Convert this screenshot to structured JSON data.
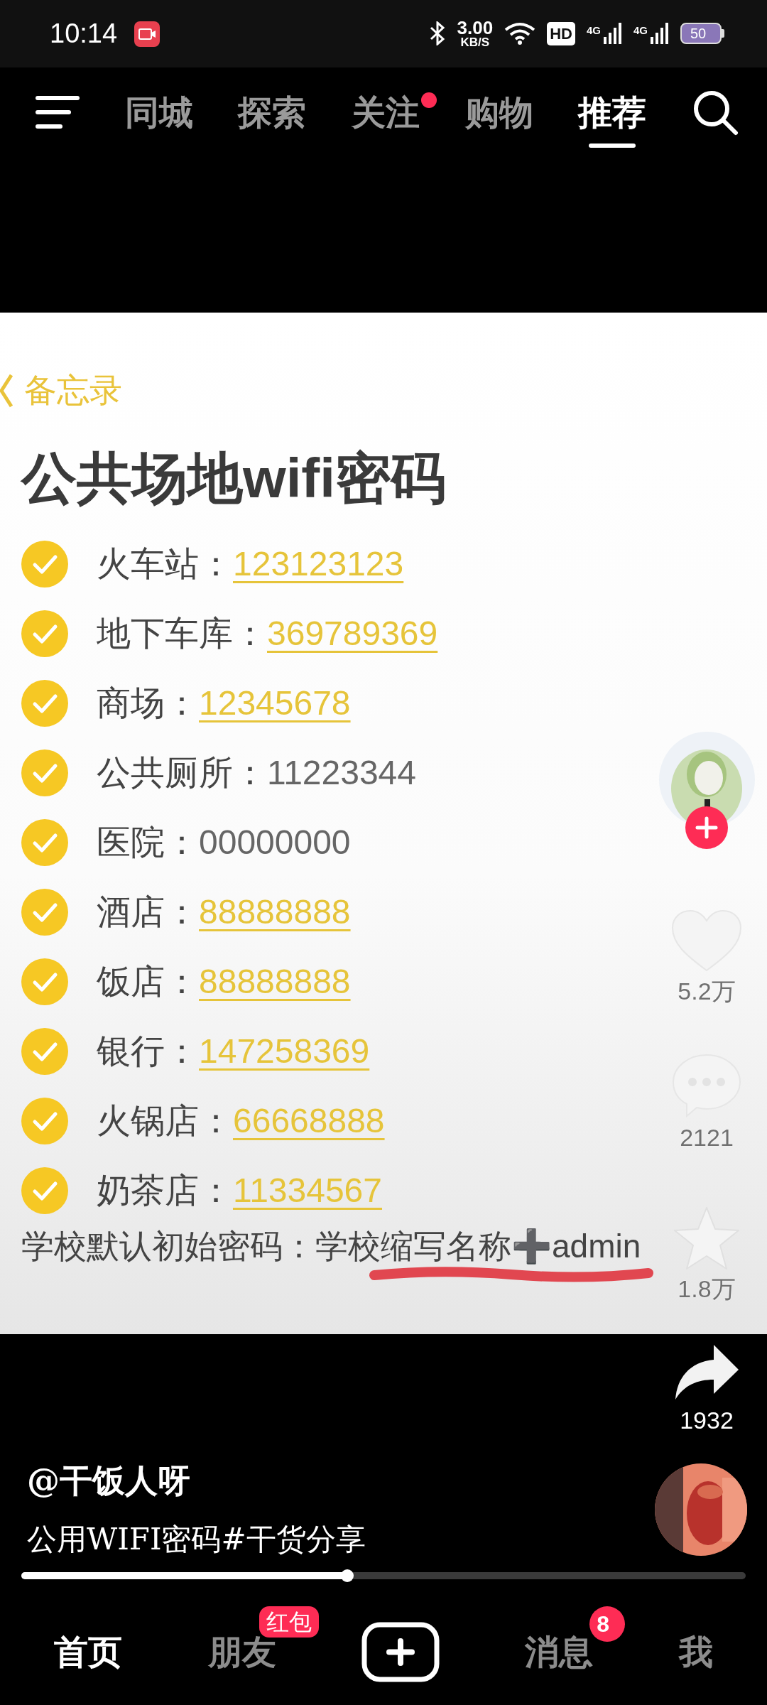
{
  "status_bar": {
    "time": "10:14",
    "speed": "3.00",
    "speed_unit": "KB/S",
    "hd": "HD",
    "networks": [
      "4G",
      "4G"
    ],
    "battery": "50"
  },
  "top_tabs": [
    {
      "label": "同城",
      "selected": false,
      "dot": false
    },
    {
      "label": "探索",
      "selected": false,
      "dot": false
    },
    {
      "label": "关注",
      "selected": false,
      "dot": true
    },
    {
      "label": "购物",
      "selected": false,
      "dot": false
    },
    {
      "label": "推荐",
      "selected": true,
      "dot": false
    }
  ],
  "memo": {
    "back_label": "备忘录",
    "title": "公共场地wifi密码",
    "items": [
      {
        "label": "火车站：",
        "value": "123123123",
        "linked": true
      },
      {
        "label": "地下车库：",
        "value": "369789369",
        "linked": true
      },
      {
        "label": "商场：",
        "value": "12345678",
        "linked": true
      },
      {
        "label": "公共厕所：",
        "value": "11223344",
        "linked": false
      },
      {
        "label": "医院：",
        "value": "00000000",
        "linked": false
      },
      {
        "label": "酒店：",
        "value": "88888888",
        "linked": true
      },
      {
        "label": "饭店：",
        "value": "88888888",
        "linked": true
      },
      {
        "label": "银行：",
        "value": "147258369",
        "linked": true
      },
      {
        "label": "火锅店：",
        "value": "66668888",
        "linked": true
      },
      {
        "label": "奶茶店：",
        "value": "11334567",
        "linked": true
      }
    ],
    "footer": "学校默认初始密码：学校缩写名称➕admin"
  },
  "actions": [
    {
      "kind": "like",
      "count": "5.2万"
    },
    {
      "kind": "comment",
      "count": "2121"
    },
    {
      "kind": "favorite",
      "count": "1.8万"
    },
    {
      "kind": "share",
      "count": "1932"
    }
  ],
  "author": "@干饭人呀",
  "caption": "公用WIFI密码#干货分享",
  "progress": {
    "level": 0.45
  },
  "bottom_nav": [
    {
      "kind": "tab",
      "label": "首页",
      "selected": true
    },
    {
      "kind": "tab",
      "label": "朋友",
      "selected": false,
      "badge": "红包"
    },
    {
      "kind": "create"
    },
    {
      "kind": "tab",
      "label": "消息",
      "selected": false,
      "badge": "8"
    },
    {
      "kind": "tab",
      "label": "我",
      "selected": false
    }
  ]
}
